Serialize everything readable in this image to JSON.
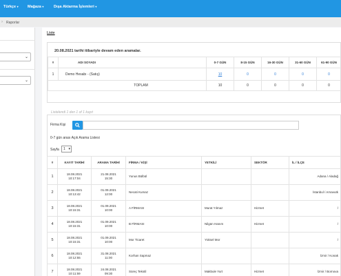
{
  "topnav": {
    "items": [
      {
        "label": "Türkçe",
        "caret": "▾"
      },
      {
        "label": "Mağaza",
        "caret": "▾"
      },
      {
        "label": "Dışa Aktarma İşlemleri",
        "caret": "▾"
      }
    ]
  },
  "breadcrumb": {
    "separator": "›",
    "current": "Raporlar"
  },
  "main": {
    "liste_link": "Liste",
    "summary": {
      "title": "20.08.2021 tarihi itibariyle devam eden aramalar.",
      "headers": [
        "#",
        "ADI SOYADI",
        "0-7 GÜN",
        "8-15 GÜN",
        "16-30 GÜN",
        "31-60 GÜN",
        "61-90 GÜN"
      ],
      "rows": [
        {
          "num": "1",
          "name": "Demo Hesabı - (Satış)",
          "values": [
            "10",
            "0",
            "0",
            "0",
            "0"
          ]
        }
      ],
      "total_label": "TOPLAM",
      "totals": [
        "10",
        "0",
        "0",
        "0",
        "0"
      ],
      "listed_text": "Listelendi 1 den 1 of 1 kayıt"
    },
    "search": {
      "label": "Firma Kişi",
      "icon": "search-icon",
      "value": ""
    },
    "list_title": "0-7 gün arası Açık Arama Listesi",
    "pager": {
      "label": "Sayfa",
      "value": "1"
    },
    "table": {
      "headers": [
        "#",
        "KAYIT TARİHİ",
        "ARAMA TARİHİ",
        "FİRMA / KİŞİ",
        "YETKİLİ",
        "SEKTÖR",
        "İL / İLÇE"
      ],
      "rows": [
        {
          "num": "1",
          "kayit_date": "18.08.2021",
          "kayit_time": "10:17:04",
          "arama_date": "21.08.2021",
          "arama_time": "15:30",
          "firma": "Yunus Bülbül",
          "yetkili": "",
          "sektor": "",
          "il": "Adana / Aladağ"
        },
        {
          "num": "2",
          "kayit_date": "18.08.2021",
          "kayit_time": "10:13:42",
          "arama_date": "01.09.2021",
          "arama_time": "12:00",
          "firma": "Necati Kumaz",
          "yetkili": "",
          "sektor": "",
          "il": "İstanbul / Arnavutk"
        },
        {
          "num": "3",
          "kayit_date": "18.08.2021",
          "kayit_time": "10:15:31",
          "arama_date": "01.09.2021",
          "arama_time": "10:00",
          "firma": "A FİRMASI",
          "yetkili": "Murat Yılmaz",
          "sektor": "Hizmet",
          "il": "/"
        },
        {
          "num": "4",
          "kayit_date": "18.08.2021",
          "kayit_time": "10:15:31",
          "arama_date": "01.09.2021",
          "arama_time": "10:00",
          "firma": "B FİRMASI",
          "yetkili": "Nilgün Hanım",
          "sektor": "Hizmet",
          "il": "/"
        },
        {
          "num": "5",
          "kayit_date": "18.08.2021",
          "kayit_time": "10:15:31",
          "arama_date": "01.09.2021",
          "arama_time": "10:00",
          "firma": "Mor Ticaret",
          "yetkili": "Yüksel Mor",
          "sektor": "",
          "il": "/"
        },
        {
          "num": "6",
          "kayit_date": "18.08.2021",
          "kayit_time": "10:12:55",
          "arama_date": "31.08.2021",
          "arama_time": "11:00",
          "firma": "Korhan Sapmaz",
          "yetkili": "",
          "sektor": "",
          "il": "İzmir / Konak"
        },
        {
          "num": "7",
          "kayit_date": "18.08.2021",
          "kayit_time": "10:11:59",
          "arama_date": "24.08.2021",
          "arama_time": "09:30",
          "firma": "Süreç Tekstil",
          "yetkili": "Makbule Yurt",
          "sektor": "Hizmet",
          "il": "İzmir / Bornova"
        }
      ]
    }
  }
}
